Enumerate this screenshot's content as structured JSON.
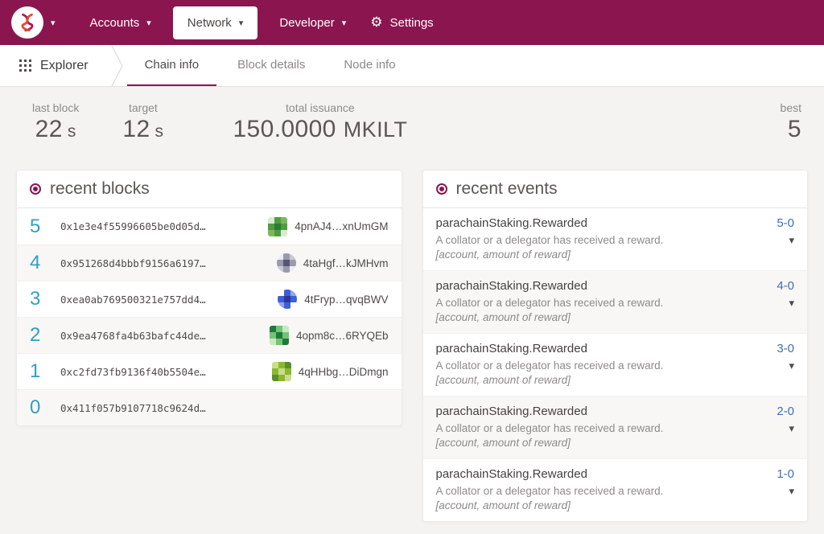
{
  "colors": {
    "brand": "#8b164f",
    "link": "#3d6eb4",
    "block_number": "#2f9fc4"
  },
  "icons": {
    "dropdown_caret": "▾",
    "expand_caret": "▾",
    "settings_gear": "⚙"
  },
  "topnav": {
    "items": [
      {
        "label": "Accounts"
      },
      {
        "label": "Network"
      },
      {
        "label": "Developer"
      },
      {
        "label": "Settings"
      }
    ]
  },
  "tabbar": {
    "app_label": "Explorer",
    "tabs": [
      {
        "label": "Chain info"
      },
      {
        "label": "Block details"
      },
      {
        "label": "Node info"
      }
    ]
  },
  "stats": {
    "last_block": {
      "label": "last block",
      "value": "22",
      "unit": "s"
    },
    "target": {
      "label": "target",
      "value": "12",
      "unit": "s"
    },
    "total_issuance": {
      "label": "total issuance",
      "value": "150.0000",
      "unit": "MKILT"
    },
    "best": {
      "label": "best",
      "value": "5"
    }
  },
  "recent_blocks": {
    "title": "recent blocks",
    "rows": [
      {
        "number": "5",
        "hash": "0x1e3e4f55996605be0d05d…",
        "author": "4pnAJ4…xnUmGM",
        "identicon": {
          "shape": "square",
          "colors": [
            "#dce8d2",
            "#4e9e3f",
            "#7cb85c",
            "#4e9e3f",
            "#2f7a33",
            "#4e9e3f",
            "#7cb85c",
            "#4e9e3f",
            "#dce8d2"
          ]
        }
      },
      {
        "number": "4",
        "hash": "0x951268d4bbbf9156a6197…",
        "author": "4taHgf…kJMHvm",
        "identicon": {
          "shape": "circle",
          "colors": [
            "#ececf2",
            "#9a9aae",
            "#c9c9d6",
            "#9a9aae",
            "#565672",
            "#9a9aae",
            "#c9c9d6",
            "#9a9aae",
            "#ececf2"
          ]
        }
      },
      {
        "number": "3",
        "hash": "0xea0ab769500321e757dd4…",
        "author": "4tFryp…qvqBWV",
        "identicon": {
          "shape": "circle",
          "colors": [
            "#ffffff",
            "#3e5fd7",
            "#8fa6ec",
            "#3e5fd7",
            "#27379e",
            "#3e5fd7",
            "#8fa6ec",
            "#3e5fd7",
            "#ffffff"
          ]
        }
      },
      {
        "number": "2",
        "hash": "0x9ea4768fa4b63bafc44de…",
        "author": "4opm8c…6RYQEb",
        "identicon": {
          "shape": "square",
          "colors": [
            "#1d7a3a",
            "#74c476",
            "#c7e9c0",
            "#74c476",
            "#1d7a3a",
            "#74c476",
            "#c7e9c0",
            "#74c476",
            "#1d7a3a"
          ]
        }
      },
      {
        "number": "1",
        "hash": "0xc2fd73fb9136f40b5504e…",
        "author": "4qHHbg…DiDmgn",
        "identicon": {
          "shape": "square",
          "colors": [
            "#c9dc8e",
            "#8bb92d",
            "#5a8f29",
            "#8bb92d",
            "#c9dc8e",
            "#8bb92d",
            "#5a8f29",
            "#8bb92d",
            "#c9dc8e"
          ]
        }
      },
      {
        "number": "0",
        "hash": "0x411f057b9107718c9624d…"
      }
    ]
  },
  "recent_events": {
    "title": "recent events",
    "rows": [
      {
        "name": "parachainStaking.Rewarded",
        "index": "5-0",
        "description": "A collator or a delegator has received a reward.",
        "params": "[account, amount of reward]"
      },
      {
        "name": "parachainStaking.Rewarded",
        "index": "4-0",
        "description": "A collator or a delegator has received a reward.",
        "params": "[account, amount of reward]"
      },
      {
        "name": "parachainStaking.Rewarded",
        "index": "3-0",
        "description": "A collator or a delegator has received a reward.",
        "params": "[account, amount of reward]"
      },
      {
        "name": "parachainStaking.Rewarded",
        "index": "2-0",
        "description": "A collator or a delegator has received a reward.",
        "params": "[account, amount of reward]"
      },
      {
        "name": "parachainStaking.Rewarded",
        "index": "1-0",
        "description": "A collator or a delegator has received a reward.",
        "params": "[account, amount of reward]"
      }
    ]
  }
}
